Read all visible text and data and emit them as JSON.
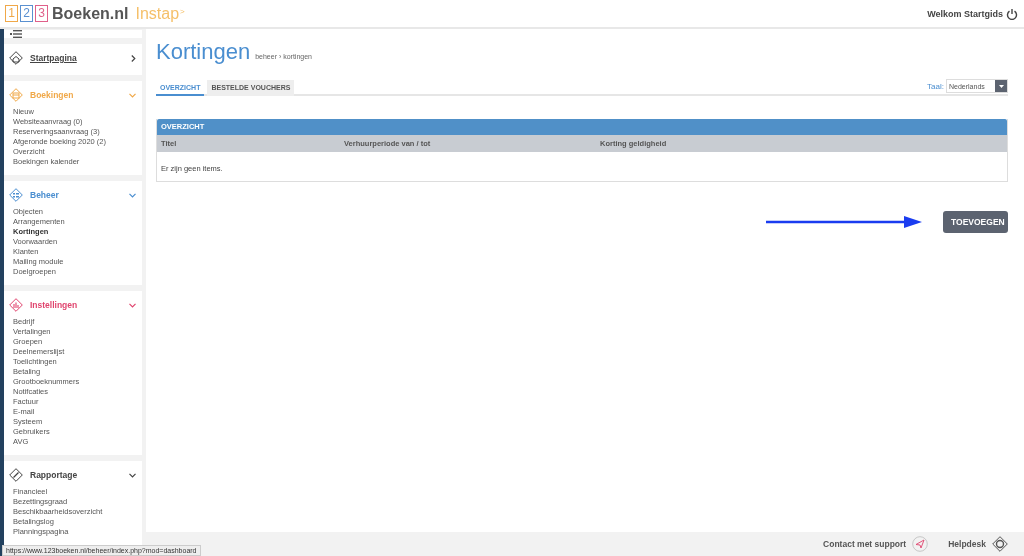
{
  "header": {
    "logo": {
      "digits": [
        {
          "text": "1",
          "color": "#f0a848"
        },
        {
          "text": "2",
          "color": "#5a90d0"
        },
        {
          "text": "3",
          "color": "#e0608a"
        }
      ],
      "brand": "Boeken.nl",
      "edition": "Instap",
      "edition_mark": ">"
    },
    "welcome": "Welkom Startgids"
  },
  "sidebar": {
    "sections": [
      {
        "title": "Startpagina",
        "kind": "home",
        "color": "#444444",
        "expanded": false
      },
      {
        "title": "Boekingen",
        "kind": "calendar",
        "color": "#f0a848",
        "expanded": true,
        "items": [
          {
            "label": "Nieuw",
            "selected": false
          },
          {
            "label": "Websiteaanvraag (0)",
            "selected": false
          },
          {
            "label": "Reserveringsaanvraag (3)",
            "selected": false
          },
          {
            "label": "Afgeronde boeking 2020 (2)",
            "selected": false
          },
          {
            "label": "Overzicht",
            "selected": false
          },
          {
            "label": "Boekingen kalender",
            "selected": false
          }
        ]
      },
      {
        "title": "Beheer",
        "kind": "list",
        "color": "#4a8ed0",
        "expanded": true,
        "items": [
          {
            "label": "Objecten",
            "selected": false
          },
          {
            "label": "Arrangementen",
            "selected": false
          },
          {
            "label": "Kortingen",
            "selected": true
          },
          {
            "label": "Voorwaarden",
            "selected": false
          },
          {
            "label": "Klanten",
            "selected": false
          },
          {
            "label": "Mailing module",
            "selected": false
          },
          {
            "label": "Doelgroepen",
            "selected": false
          }
        ]
      },
      {
        "title": "Instellingen",
        "kind": "settings",
        "color": "#e0456e",
        "expanded": true,
        "items": [
          {
            "label": "Bedrijf",
            "selected": false
          },
          {
            "label": "Vertalingen",
            "selected": false
          },
          {
            "label": "Groepen",
            "selected": false
          },
          {
            "label": "Deelnemerslijst",
            "selected": false
          },
          {
            "label": "Toelichtingen",
            "selected": false
          },
          {
            "label": "Betaling",
            "selected": false
          },
          {
            "label": "Grootboeknummers",
            "selected": false
          },
          {
            "label": "Notifcaties",
            "selected": false
          },
          {
            "label": "Factuur",
            "selected": false
          },
          {
            "label": "E-mail",
            "selected": false
          },
          {
            "label": "Systeem",
            "selected": false
          },
          {
            "label": "Gebruikers",
            "selected": false
          },
          {
            "label": "AVG",
            "selected": false
          }
        ]
      },
      {
        "title": "Rapportage",
        "kind": "chart",
        "color": "#444444",
        "expanded": true,
        "items": [
          {
            "label": "Financieel",
            "selected": false
          },
          {
            "label": "Bezettingsgraad",
            "selected": false
          },
          {
            "label": "Beschikbaarheidsoverzicht",
            "selected": false
          },
          {
            "label": "Betalingslog",
            "selected": false
          },
          {
            "label": "Planningspagina",
            "selected": false
          }
        ]
      }
    ]
  },
  "page": {
    "title": "Kortingen",
    "breadcrumb": "beheer › kortingen",
    "tabs": [
      {
        "label": "OVERZICHT",
        "selected": true
      },
      {
        "label": "BESTELDE VOUCHERS",
        "selected": false
      }
    ],
    "language": {
      "label": "Taal:",
      "value": "Nederlands"
    },
    "table": {
      "title": "OVERZICHT",
      "columns": [
        "Titel",
        "Verhuurperiode van / tot",
        "Korting geldigheid"
      ],
      "empty_text": "Er zijn geen items."
    },
    "add_button": "TOEVOEGEN"
  },
  "footer": {
    "links": [
      {
        "label": "Contact met support",
        "kind": "send"
      },
      {
        "label": "Helpdesk",
        "kind": "lifebuoy"
      }
    ]
  },
  "status_url": "https://www.123boeken.nl/beheer/index.php?mod=dashboard"
}
